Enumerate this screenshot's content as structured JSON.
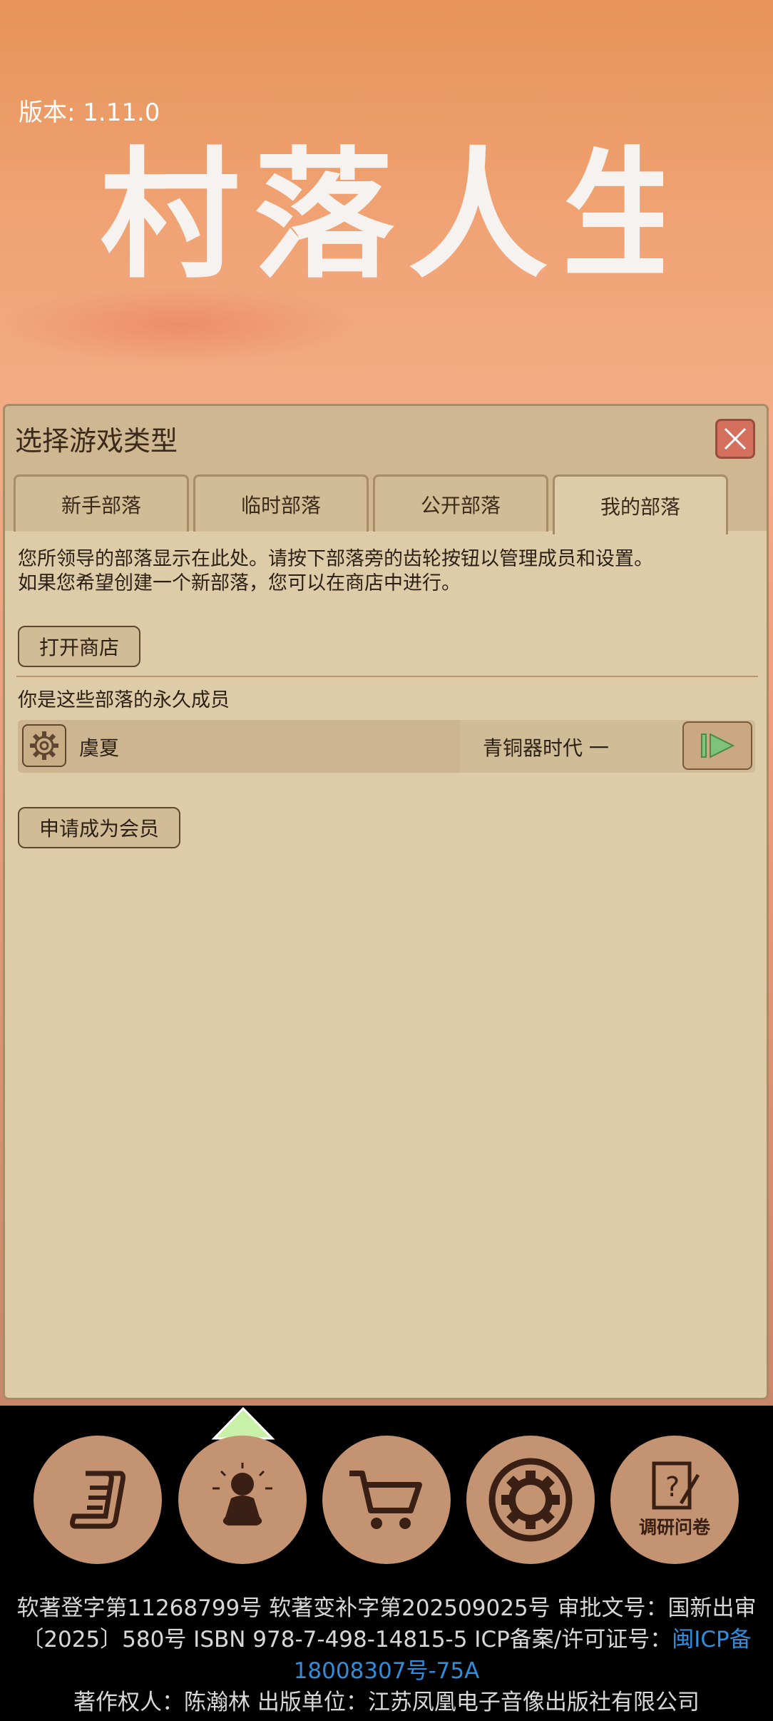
{
  "version_text": "版本: 1.11.0",
  "logo_text": "村落人生",
  "dialog": {
    "title": "选择游戏类型",
    "tabs": [
      {
        "label": "新手部落",
        "active": false
      },
      {
        "label": "临时部落",
        "active": false
      },
      {
        "label": "公开部落",
        "active": false
      },
      {
        "label": "我的部落",
        "active": true
      }
    ],
    "description_line1": "您所领导的部落显示在此处。请按下部落旁的齿轮按钮以管理成员和设置。",
    "description_line2": "如果您希望创建一个新部落，您可以在商店中进行。",
    "open_shop_label": "打开商店",
    "members_label": "你是这些部落的永久成员",
    "tribes": [
      {
        "name": "虞夏",
        "era": "青铜器时代 一"
      }
    ],
    "apply_member_label": "申请成为会员"
  },
  "dock": [
    {
      "name": "scroll-icon"
    },
    {
      "name": "meditation-icon"
    },
    {
      "name": "cart-icon"
    },
    {
      "name": "settings-icon"
    },
    {
      "name": "survey-icon",
      "label": "调研问卷"
    }
  ],
  "footer": {
    "line1": "软著登字第11268799号 软著变补字第202509025号 审批文号：国新出审",
    "line2_text": "〔2025〕580号 ISBN 978-7-498-14815-5 ICP备案/许可证号：",
    "line2_link": "闽ICP备",
    "line3_link": "18008307号-75A",
    "line4": "著作权人：陈瀚林 出版单位：江苏凤凰电子音像出版社有限公司"
  },
  "colors": {
    "panel_bg": "#decca9",
    "close_btn": "#d5705e",
    "dock_circle": "#c49371",
    "link": "#2f8ddb"
  }
}
